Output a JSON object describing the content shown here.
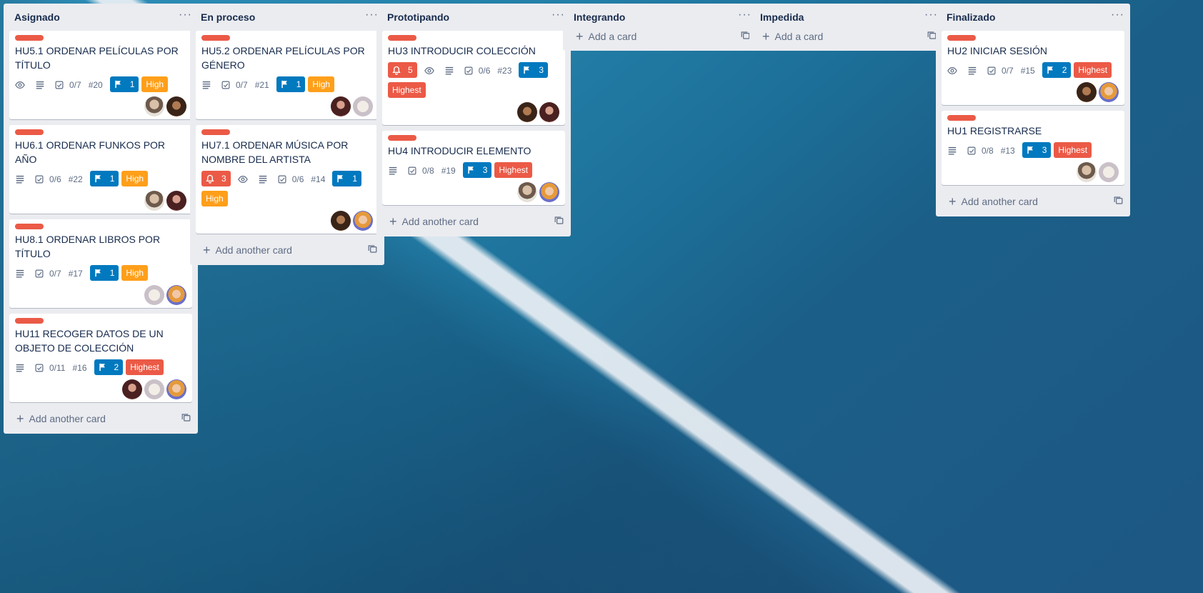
{
  "board": {
    "lists": [
      {
        "title": "Asignado",
        "menu": "···",
        "add_label": "Add another card",
        "cards": [
          {
            "title": "HU5.1 ORDENAR PELÍCULAS POR TÍTULO",
            "badges": [
              "eye",
              "desc"
            ],
            "checklist": "0/7",
            "number": "#20",
            "flag": "1",
            "priority": "High",
            "priority_color": "orange",
            "members": [
              "man",
              "woman-dark"
            ]
          },
          {
            "title": "HU6.1 ORDENAR FUNKOS POR AÑO",
            "badges": [
              "desc"
            ],
            "checklist": "0/6",
            "number": "#22",
            "flag": "1",
            "priority": "High",
            "priority_color": "orange",
            "members": [
              "man",
              "woman-red"
            ]
          },
          {
            "title": "HU8.1 ORDENAR LIBROS POR TÍTULO",
            "badges": [
              "desc"
            ],
            "checklist": "0/7",
            "number": "#17",
            "flag": "1",
            "priority": "High",
            "priority_color": "orange",
            "members": [
              "cat",
              "anime"
            ]
          },
          {
            "title": "HU11 RECOGER DATOS DE UN OBJETO DE COLECCIÓN",
            "badges": [
              "desc"
            ],
            "checklist": "0/11",
            "number": "#16",
            "flag": "2",
            "priority": "Highest",
            "priority_color": "red",
            "members": [
              "woman-red",
              "cat",
              "anime"
            ]
          }
        ]
      },
      {
        "title": "En proceso",
        "menu": "···",
        "add_label": "Add another card",
        "cards": [
          {
            "title": "HU5.2 ORDENAR PELÍCULAS POR GÉNERO",
            "badges": [
              "desc"
            ],
            "checklist": "0/7",
            "number": "#21",
            "flag": "1",
            "priority": "High",
            "priority_color": "orange",
            "members": [
              "woman-red",
              "cat"
            ]
          },
          {
            "title": "HU7.1 ORDENAR MÚSICA POR NOMBRE DEL ARTISTA",
            "alert": "3",
            "badges": [
              "eye",
              "desc"
            ],
            "checklist": "0/6",
            "number": "#14",
            "flag": "1",
            "priority": "High",
            "priority_color": "orange",
            "members": [
              "woman-dark",
              "anime"
            ]
          }
        ]
      },
      {
        "title": "Prototipando",
        "menu": "···",
        "add_label": "Add another card",
        "cards": [
          {
            "title": "HU3 INTRODUCIR COLECCIÓN",
            "alert": "5",
            "badges": [
              "eye",
              "desc"
            ],
            "checklist": "0/6",
            "number": "#23",
            "flag": "3",
            "priority": "Highest",
            "priority_color": "red",
            "members": [
              "woman-dark",
              "woman-red"
            ]
          },
          {
            "title": "HU4 INTRODUCIR ELEMENTO",
            "badges": [
              "desc"
            ],
            "checklist": "0/8",
            "number": "#19",
            "flag": "3",
            "priority": "Highest",
            "priority_color": "red",
            "members": [
              "man",
              "anime"
            ]
          }
        ]
      },
      {
        "title": "Integrando",
        "menu": "···",
        "add_label": "Add a card",
        "cards": []
      },
      {
        "title": "Impedida",
        "menu": "···",
        "add_label": "Add a card",
        "cards": []
      },
      {
        "title": "Finalizado",
        "menu": "···",
        "add_label": "Add another card",
        "cards": [
          {
            "title": "HU2 INICIAR SESIÓN",
            "badges": [
              "eye",
              "desc"
            ],
            "checklist": "0/7",
            "number": "#15",
            "flag": "2",
            "priority": "Highest",
            "priority_color": "red",
            "members": [
              "woman-dark",
              "anime"
            ]
          },
          {
            "title": "HU1 REGISTRARSE",
            "badges": [
              "desc"
            ],
            "checklist": "0/8",
            "number": "#13",
            "flag": "3",
            "priority": "Highest",
            "priority_color": "red",
            "members": [
              "man",
              "cat"
            ]
          }
        ]
      }
    ]
  },
  "colors": {
    "label_red": "#eb5a46",
    "chip_blue": "#0079bf",
    "chip_orange": "#ff9f1a",
    "chip_red": "#eb5a46",
    "list_bg": "#ebecf0"
  }
}
